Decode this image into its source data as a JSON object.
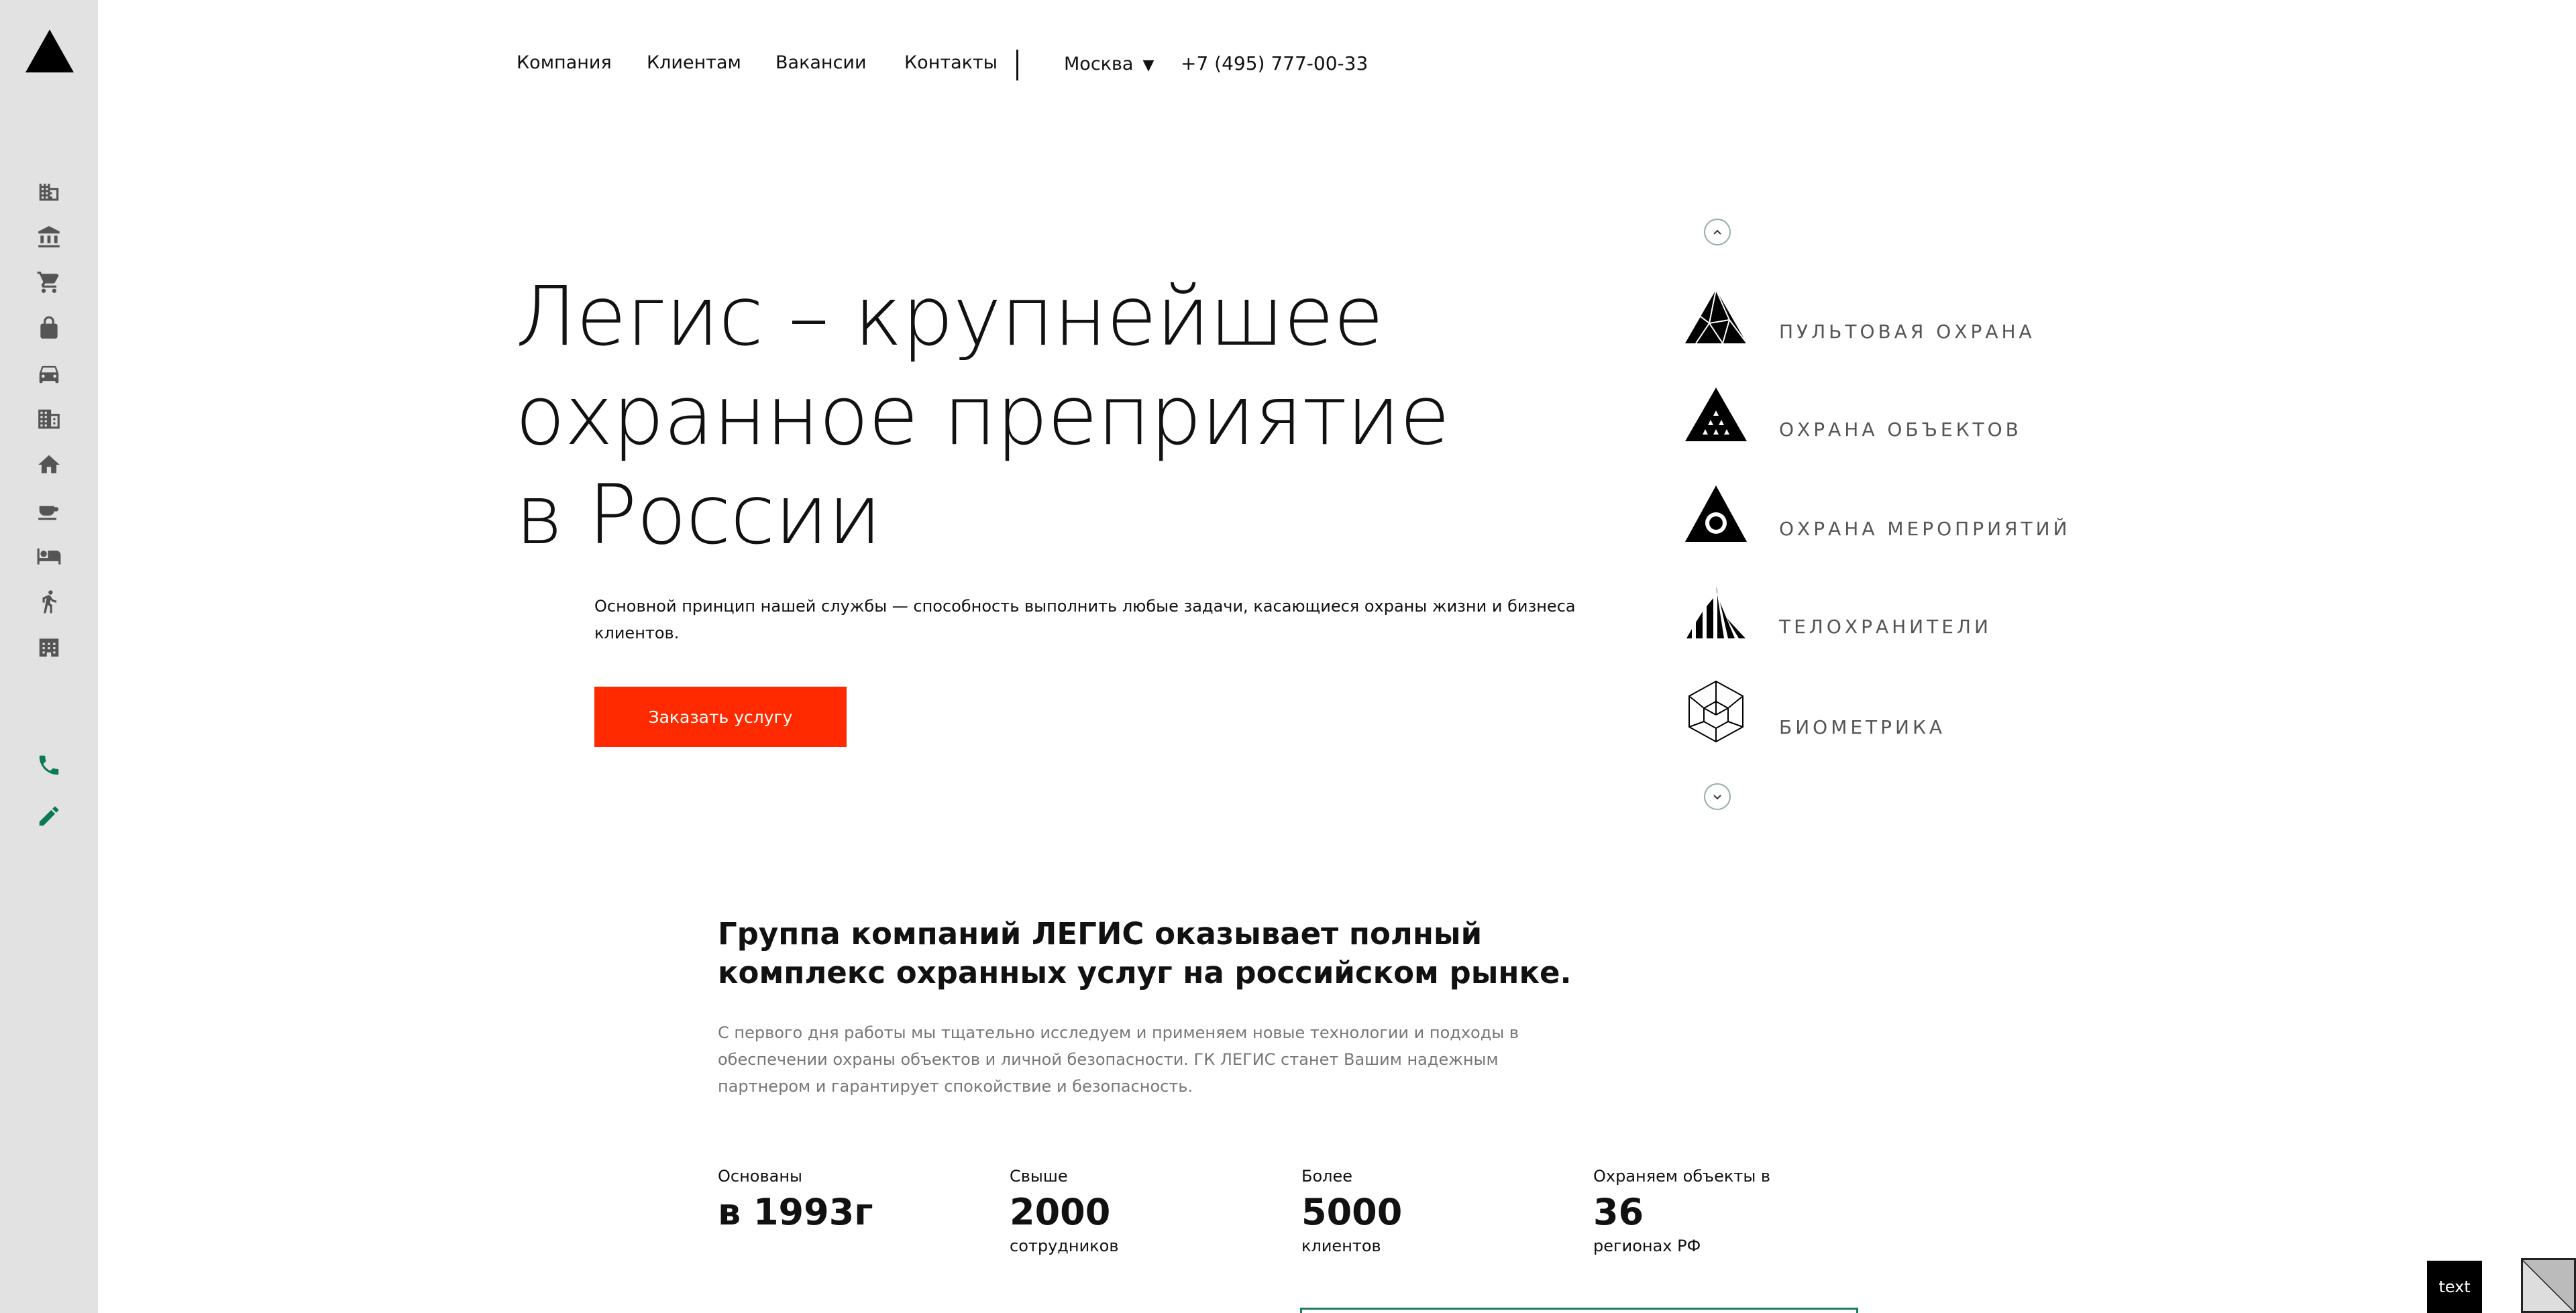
{
  "sidebar": {
    "icons": [
      "office-building-icon",
      "bank-icon",
      "shopping-cart-icon",
      "lock-icon",
      "car-icon",
      "apartment-building-icon",
      "home-icon",
      "coffee-cup-icon",
      "hotel-bed-icon",
      "running-person-icon",
      "business-center-icon"
    ],
    "contact_icons": [
      "phone-icon",
      "pencil-icon"
    ],
    "accent_color": "#0a7a52"
  },
  "nav": {
    "links": [
      "Компания",
      "Клиентам",
      "Вакансии",
      "Контакты"
    ],
    "city": "Москва",
    "phone": "+7 (495) 777-00-33"
  },
  "hero": {
    "title": "Легис – крупнейшее охранное преприятие в России",
    "subtitle": "Основной принцип нашей службы — способность выполнить любые задачи, касающиеся охраны жизни и бизнеса клиентов.",
    "cta": "Заказать услугу",
    "cta_color": "#ff2a00"
  },
  "services": [
    {
      "label": "ПУЛЬТОВАЯ ОХРАНА",
      "icon": "triangle-network-icon"
    },
    {
      "label": "ОХРАНА ОБЪЕКТОВ",
      "icon": "triangle-dots-icon"
    },
    {
      "label": "ОХРАНА МЕРОПРИЯТИЙ",
      "icon": "triangle-eye-icon"
    },
    {
      "label": "ТЕЛОХРАНИТЕЛИ",
      "icon": "triangle-stripes-icon"
    },
    {
      "label": "БИОМЕТРИКА",
      "icon": "cube-outline-icon"
    }
  ],
  "about": {
    "title": "Группа компаний ЛЕГИС оказывает полный комплекс охранных услуг на российском рынке.",
    "text": "С первого дня работы мы тщательно исследуем и применяем новые технологии и подходы в обеспечении охраны объектов и личной безопасности. ГК ЛЕГИС станет Вашим надежным партнером и гарантирует спокойствие и безопасность."
  },
  "stats": [
    {
      "label": "Основаны",
      "value": "в 1993г",
      "unit": ""
    },
    {
      "label": "Свыше",
      "value": "2000",
      "unit": "сотрудников"
    },
    {
      "label": "Более",
      "value": "5000",
      "unit": "клиентов"
    },
    {
      "label": "Охраняем объекты в",
      "value": "36",
      "unit": "регионах РФ"
    }
  ],
  "badge": "text"
}
